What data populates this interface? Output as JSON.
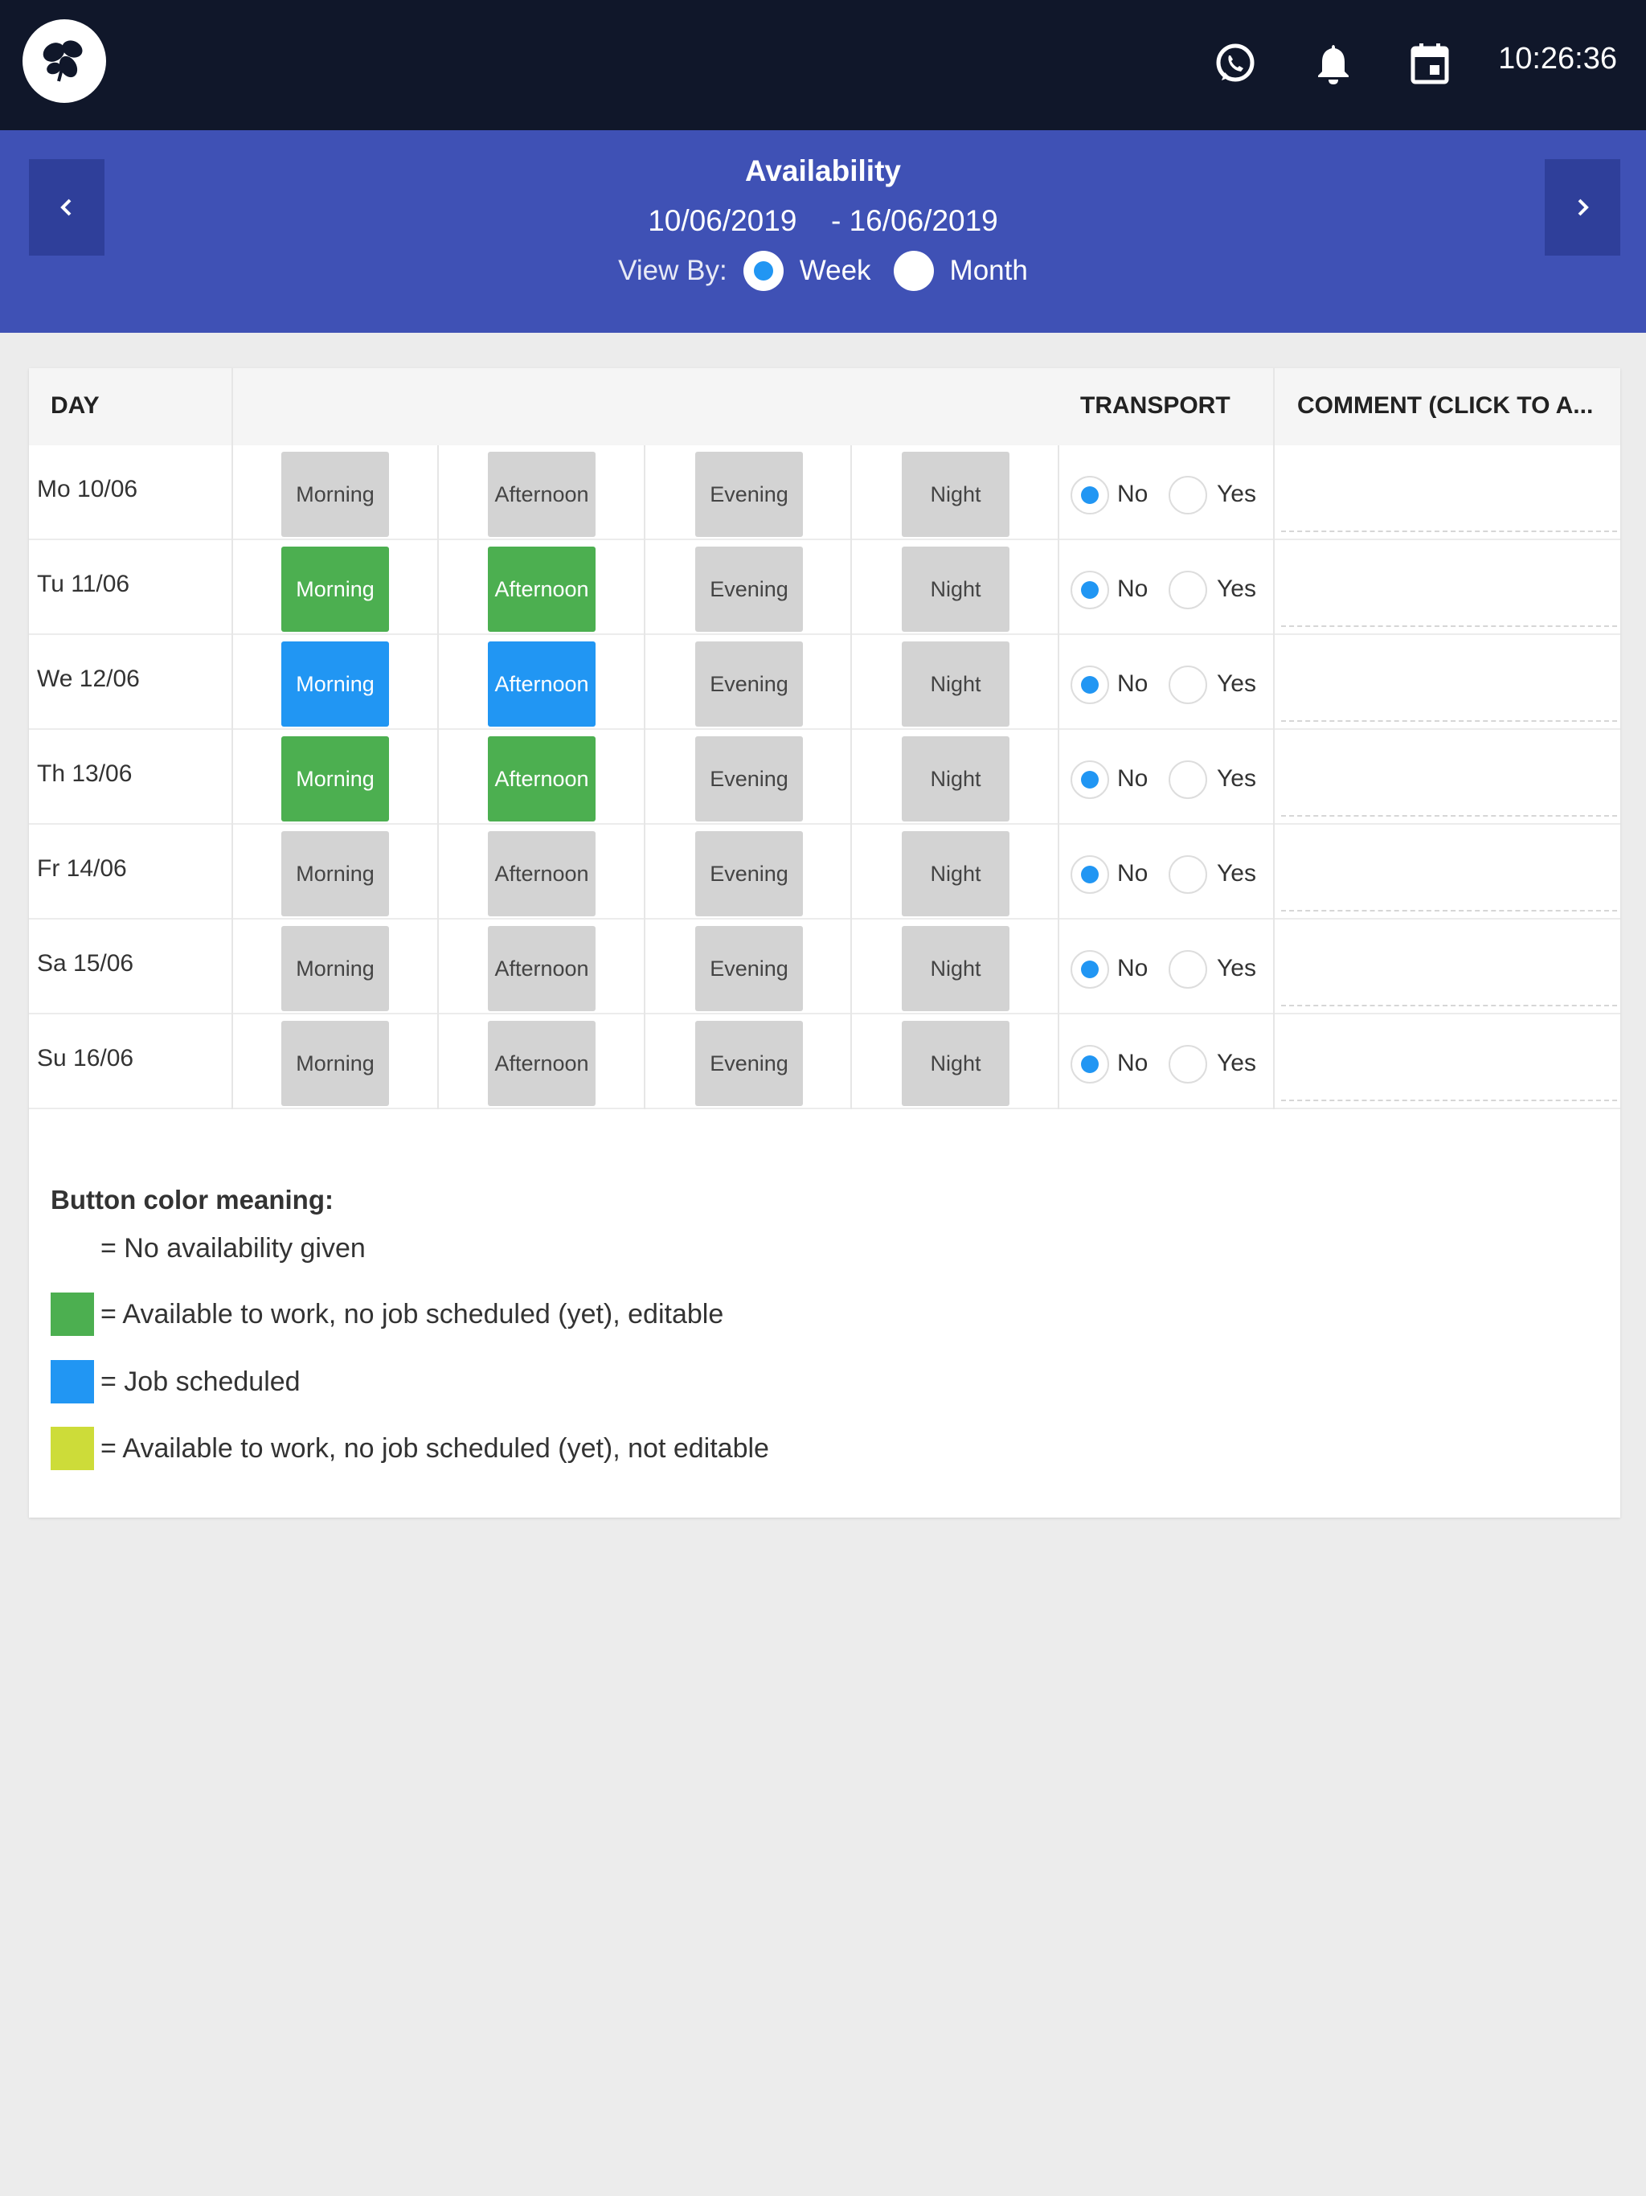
{
  "topbar": {
    "logo": "clover-logo",
    "icons": [
      "whatsapp-icon",
      "bell-icon",
      "calendar-icon"
    ],
    "time": "10:26:36"
  },
  "header": {
    "title": "Availability",
    "date_from": "10/06/2019",
    "date_to": "- 16/06/2019",
    "view_by_label": "View By:",
    "view_options": [
      {
        "label": "Week",
        "selected": true
      },
      {
        "label": "Month",
        "selected": false
      }
    ]
  },
  "table": {
    "headers": {
      "day": "DAY",
      "transport": "TRANSPORT",
      "comment": "COMMENT (CLICK TO A..."
    },
    "slot_labels": [
      "Morning",
      "Afternoon",
      "Evening",
      "Night"
    ],
    "transport_options": [
      "No",
      "Yes"
    ],
    "rows": [
      {
        "day": "Mo 10/06",
        "slots": [
          "none",
          "none",
          "none",
          "none"
        ],
        "transport": "No",
        "comment": ""
      },
      {
        "day": "Tu 11/06",
        "slots": [
          "available",
          "available",
          "none",
          "none"
        ],
        "transport": "No",
        "comment": ""
      },
      {
        "day": "We 12/06",
        "slots": [
          "scheduled",
          "scheduled",
          "none",
          "none"
        ],
        "transport": "No",
        "comment": ""
      },
      {
        "day": "Th 13/06",
        "slots": [
          "available",
          "available",
          "none",
          "none"
        ],
        "transport": "No",
        "comment": ""
      },
      {
        "day": "Fr 14/06",
        "slots": [
          "none",
          "none",
          "none",
          "none"
        ],
        "transport": "No",
        "comment": ""
      },
      {
        "day": "Sa 15/06",
        "slots": [
          "none",
          "none",
          "none",
          "none"
        ],
        "transport": "No",
        "comment": ""
      },
      {
        "day": "Su 16/06",
        "slots": [
          "none",
          "none",
          "none",
          "none"
        ],
        "transport": "No",
        "comment": ""
      }
    ]
  },
  "legend": {
    "title": "Button color meaning:",
    "items": [
      {
        "color": "none",
        "text": "= No availability given"
      },
      {
        "color": "#4caf50",
        "text": "= Available to work, no job scheduled (yet), editable"
      },
      {
        "color": "#2196f3",
        "text": "= Job scheduled"
      },
      {
        "color": "#cddc39",
        "text": "= Available to work, no job scheduled (yet), not editable"
      }
    ]
  },
  "colors": {
    "topbar": "#10172a",
    "header": "#3f51b5",
    "nav_button": "#2f3f9a",
    "unset": "#d3d3d3",
    "available": "#4caf50",
    "scheduled": "#2196f3",
    "available_locked": "#cddc39"
  }
}
